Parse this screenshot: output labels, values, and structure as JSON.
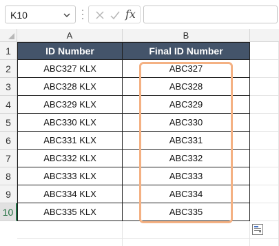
{
  "formula_bar": {
    "name_box": "K10",
    "fx_label": "fx",
    "formula": ""
  },
  "columns": [
    "A",
    "B"
  ],
  "rows": [
    "1",
    "2",
    "3",
    "4",
    "5",
    "6",
    "7",
    "8",
    "9",
    "10"
  ],
  "table": {
    "headers": [
      "ID Number",
      "Final ID Number"
    ],
    "data": [
      [
        "ABC327 KLX",
        "ABC327"
      ],
      [
        "ABC328 KLX",
        "ABC328"
      ],
      [
        "ABC329 KLX",
        "ABC329"
      ],
      [
        "ABC330 KLX",
        "ABC330"
      ],
      [
        "ABC331 KLX",
        "ABC331"
      ],
      [
        "ABC332 KLX",
        "ABC332"
      ],
      [
        "ABC333 KLX",
        "ABC333"
      ],
      [
        "ABC334 KLX",
        "ABC334"
      ],
      [
        "ABC335 KLX",
        "ABC335"
      ]
    ]
  },
  "colors": {
    "header_fill": "#44546a",
    "highlight": "#f4b183",
    "active_row": "#217346"
  }
}
